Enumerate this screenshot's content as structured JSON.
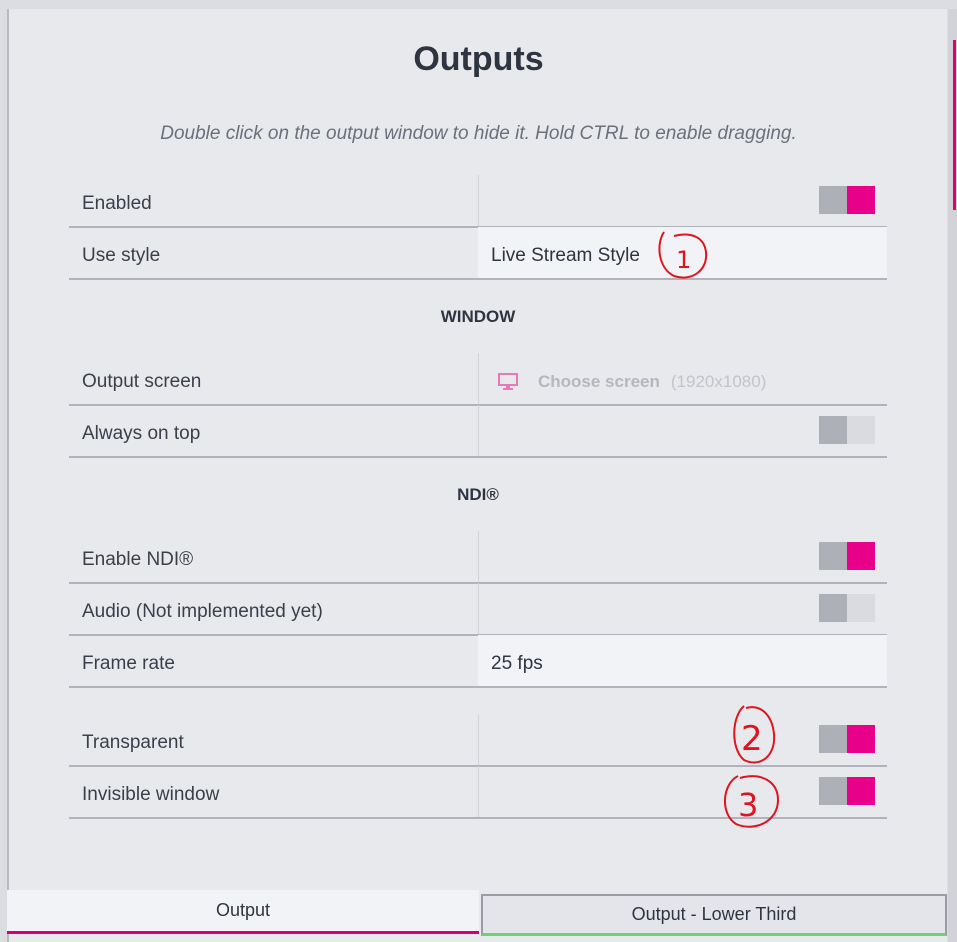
{
  "title": "Outputs",
  "hint": "Double click on the output window to hide it. Hold CTRL to enable dragging.",
  "general": {
    "enabled_label": "Enabled",
    "enabled_state": true,
    "use_style_label": "Use style",
    "use_style_value": "Live Stream Style"
  },
  "window_section": {
    "heading": "WINDOW",
    "output_screen_label": "Output screen",
    "output_screen_value": "Choose screen",
    "output_screen_res": "(1920x1080)",
    "always_on_top_label": "Always on top",
    "always_on_top_state": false
  },
  "ndi_section": {
    "heading": "NDI®",
    "enable_ndi_label": "Enable NDI®",
    "enable_ndi_state": true,
    "audio_label": "Audio (Not implemented yet)",
    "audio_state": false,
    "frame_rate_label": "Frame rate",
    "frame_rate_value": "25 fps"
  },
  "extra": {
    "transparent_label": "Transparent",
    "transparent_state": true,
    "invisible_label": "Invisible window",
    "invisible_state": true
  },
  "annotations": [
    "1",
    "2",
    "3"
  ],
  "tabs": [
    {
      "label": "Output",
      "active": true
    },
    {
      "label": "Output - Lower Third",
      "active": false
    }
  ],
  "colors": {
    "accent": "#e8008a",
    "toggle_off": "#dadbe0",
    "annotation": "#e0141e",
    "tab_active_underline": "#d8006f",
    "tab_inactive_underline": "#6cd46c"
  }
}
